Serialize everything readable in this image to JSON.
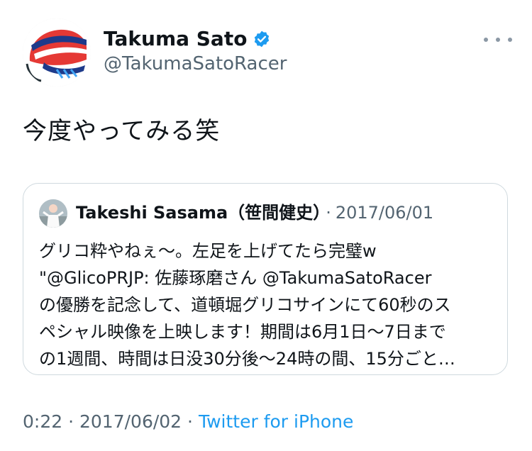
{
  "author": {
    "name": "Takuma Sato",
    "handle": "@TakumaSatoRacer",
    "verified": true
  },
  "tweet": {
    "text": "今度やってみる笑"
  },
  "quoted_tweet": {
    "author_name": "Takeshi Sasama（笹間健史）",
    "separator": "·",
    "date": "2017/06/01",
    "lines": [
      "グリコ粋やねぇ〜。左足を上げてたら完璧w",
      "\"@GlicoPRJP: 佐藤琢磨さん @TakumaSatoRacer",
      "の優勝を記念して、道頓堀グリコサインにて60秒のス",
      "ペシャル映像を上映します！期間は6月1日〜7日まで",
      "の1週間、時間は日没30分後〜24時の間、15分ごと…"
    ]
  },
  "meta": {
    "time": "0:22",
    "separator": "·",
    "date": "2017/06/02",
    "source": "Twitter for iPhone"
  },
  "colors": {
    "text": "#0f1419",
    "secondary": "#536471",
    "link": "#1d9bf0",
    "verified_badge": "#1d9bf0",
    "border": "#cfd9de"
  },
  "icons": {
    "verified": "verified-badge-icon",
    "more": "more-dots-icon"
  }
}
